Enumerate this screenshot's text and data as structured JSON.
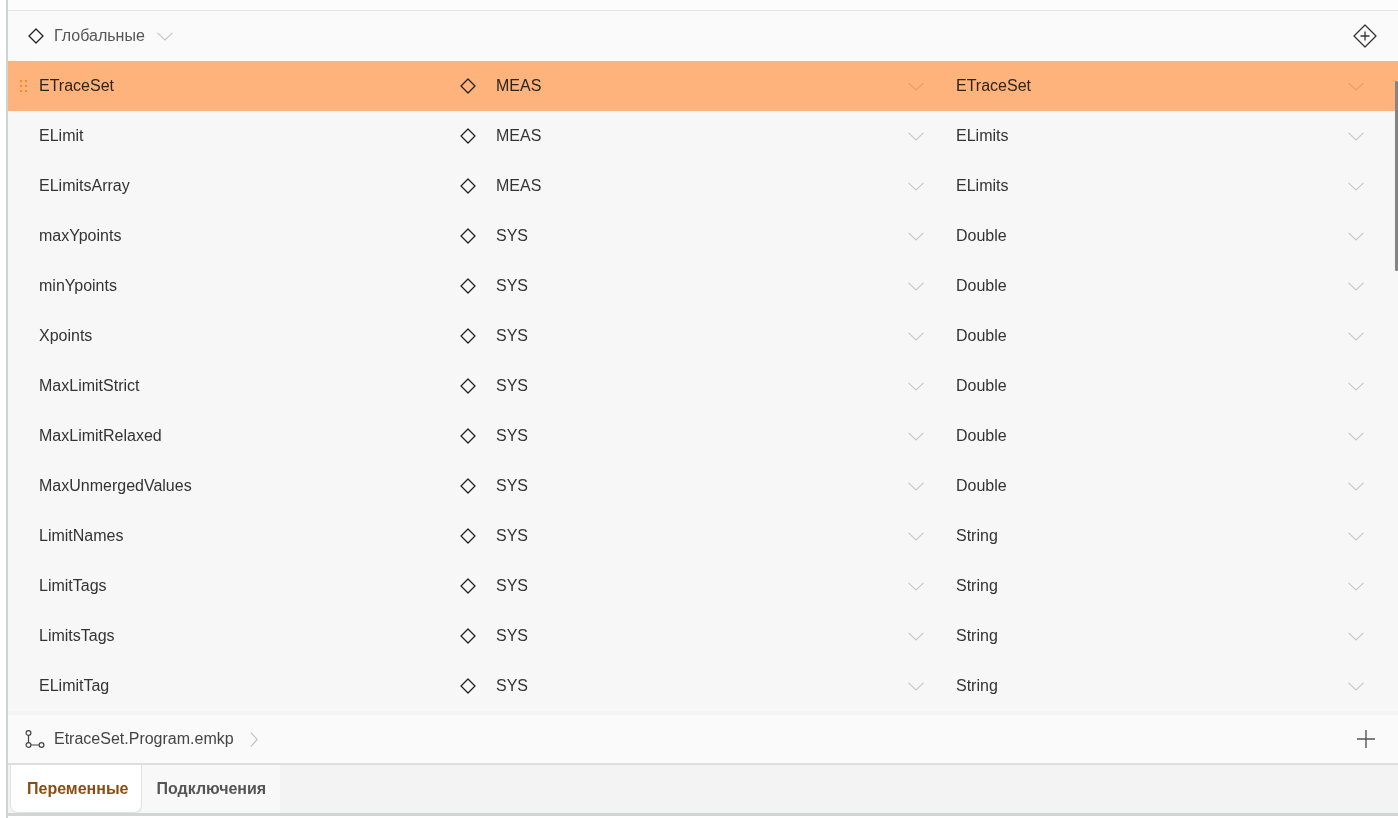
{
  "scope_filter": {
    "value": "Глобальные"
  },
  "variables": [
    {
      "name": "ETraceSet",
      "column_2": "MEAS",
      "column_3": "ETraceSet",
      "selected": true
    },
    {
      "name": "ELimit",
      "column_2": "MEAS",
      "column_3": "ELimits",
      "selected": false
    },
    {
      "name": "ELimitsArray",
      "column_2": "MEAS",
      "column_3": "ELimits",
      "selected": false
    },
    {
      "name": "maxYpoints",
      "column_2": "SYS",
      "column_3": "Double",
      "selected": false
    },
    {
      "name": "minYpoints",
      "column_2": "SYS",
      "column_3": "Double",
      "selected": false
    },
    {
      "name": "Xpoints",
      "column_2": "SYS",
      "column_3": "Double",
      "selected": false
    },
    {
      "name": "MaxLimitStrict",
      "column_2": "SYS",
      "column_3": "Double",
      "selected": false
    },
    {
      "name": "MaxLimitRelaxed",
      "column_2": "SYS",
      "column_3": "Double",
      "selected": false
    },
    {
      "name": "MaxUnmergedValues",
      "column_2": "SYS",
      "column_3": "Double",
      "selected": false
    },
    {
      "name": "LimitNames",
      "column_2": "SYS",
      "column_3": "String",
      "selected": false
    },
    {
      "name": "LimitTags",
      "column_2": "SYS",
      "column_3": "String",
      "selected": false
    },
    {
      "name": "LimitsTags",
      "column_2": "SYS",
      "column_3": "String",
      "selected": false
    },
    {
      "name": "ELimitTag",
      "column_2": "SYS",
      "column_3": "String",
      "selected": false
    }
  ],
  "breadcrumb": {
    "label": "EtraceSet.Program.emkp"
  },
  "tabs": [
    {
      "label": "Переменные",
      "selected": true
    },
    {
      "label": "Подключения",
      "selected": false
    }
  ]
}
